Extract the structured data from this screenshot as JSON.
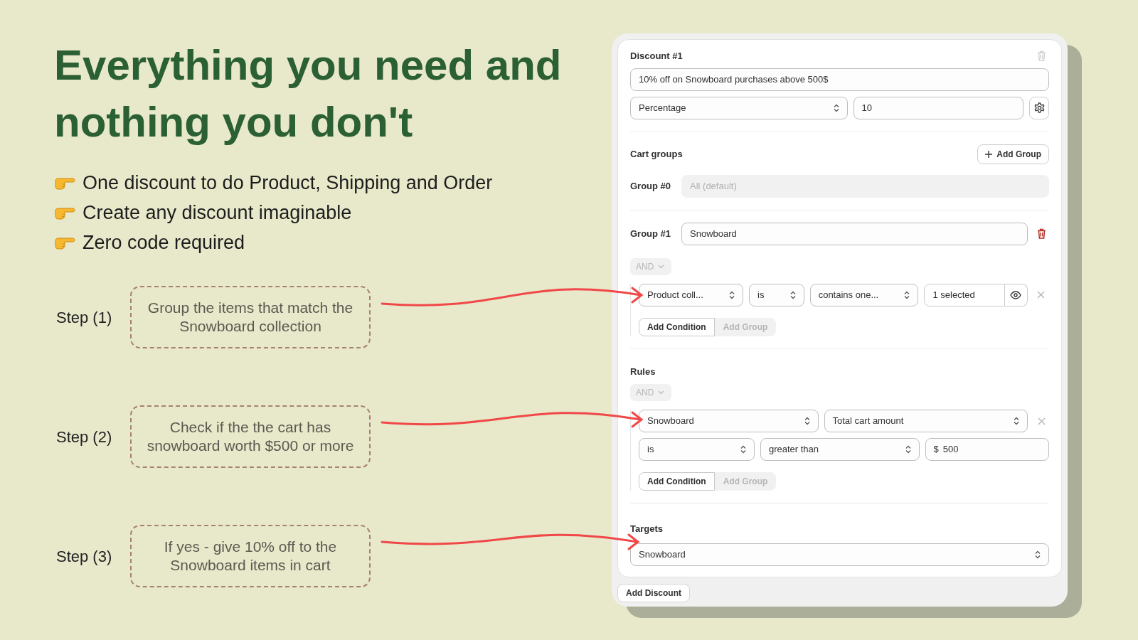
{
  "headline": "Everything you need and nothing you don't",
  "bullets": [
    "One discount to do Product, Shipping and Order",
    "Create any discount imaginable",
    "Zero code required"
  ],
  "steps": [
    {
      "label": "Step (1)",
      "text": "Group the items that match the Snowboard collection"
    },
    {
      "label": "Step (2)",
      "text": "Check if the the cart has snowboard worth $500 or more"
    },
    {
      "label": "Step (3)",
      "text": "If yes - give 10% off to the Snowboard items in cart"
    }
  ],
  "discount": {
    "title": "Discount #1",
    "delete_disabled": true,
    "name_value": "10% off on Snowboard purchases above 500$",
    "type_value": "Percentage",
    "amount_value": "10"
  },
  "cart_groups": {
    "title": "Cart groups",
    "add_button": "Add Group",
    "groups": [
      {
        "label": "Group #0",
        "placeholder": "All (default)",
        "disabled": true,
        "deletable": false
      },
      {
        "label": "Group #1",
        "value": "Snowboard",
        "disabled": false,
        "deletable": true,
        "operator": "AND",
        "conditions": [
          {
            "removable": true,
            "fields": [
              {
                "kind": "select",
                "value": "Product coll..."
              },
              {
                "kind": "select",
                "value": "is"
              },
              {
                "kind": "select",
                "value": "contains one..."
              },
              {
                "kind": "picker",
                "value": "1 selected"
              }
            ]
          }
        ],
        "buttons": [
          {
            "label": "Add Condition",
            "disabled": false
          },
          {
            "label": "Add Group",
            "disabled": true
          }
        ]
      }
    ]
  },
  "rules": {
    "title": "Rules",
    "operator": "AND",
    "conditions": [
      {
        "removable": true,
        "fields": [
          {
            "kind": "select",
            "value": "Snowboard"
          },
          {
            "kind": "select",
            "value": "Total cart amount"
          }
        ]
      },
      {
        "removable": false,
        "fields": [
          {
            "kind": "select",
            "value": "is"
          },
          {
            "kind": "select",
            "value": "greater than"
          },
          {
            "kind": "money",
            "prefix": "$",
            "value": "500"
          }
        ]
      }
    ],
    "buttons": [
      {
        "label": "Add Condition",
        "disabled": false
      },
      {
        "label": "Add Group",
        "disabled": true
      }
    ]
  },
  "targets": {
    "title": "Targets",
    "value": "Snowboard"
  },
  "add_discount": "Add Discount"
}
